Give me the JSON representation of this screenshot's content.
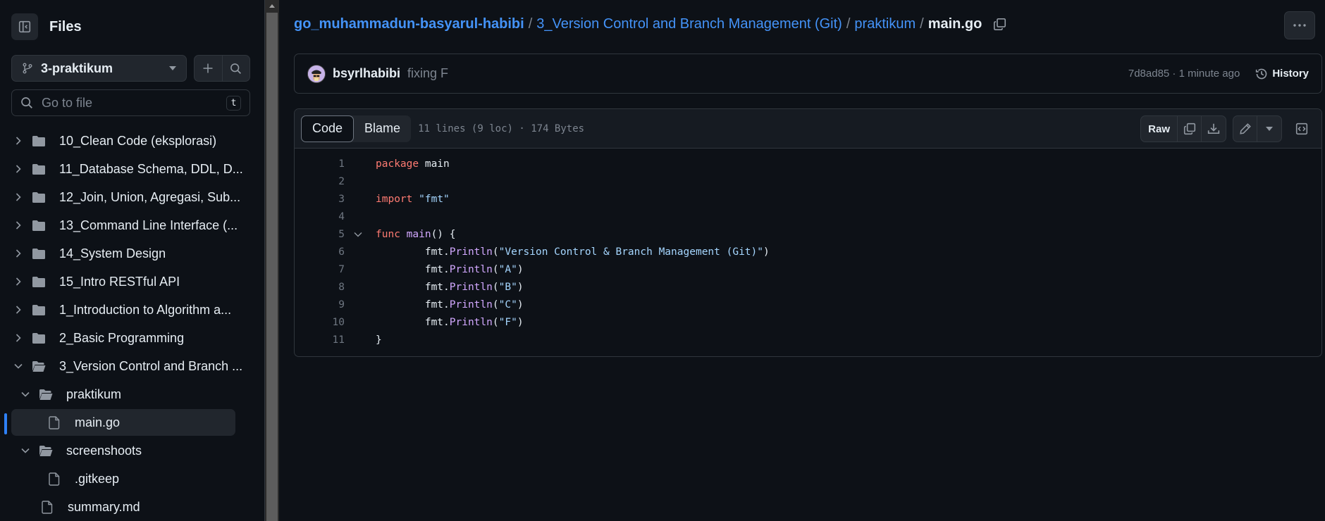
{
  "sidebar": {
    "title": "Files",
    "branch": "3-praktikum",
    "goto_placeholder": "Go to file",
    "goto_shortcut": "t",
    "tree": [
      {
        "label": "10_Clean Code (eksplorasi)",
        "type": "folder",
        "expanded": false
      },
      {
        "label": "11_Database Schema, DDL, D...",
        "type": "folder",
        "expanded": false
      },
      {
        "label": "12_Join, Union, Agregasi, Sub...",
        "type": "folder",
        "expanded": false
      },
      {
        "label": "13_Command Line Interface (...",
        "type": "folder",
        "expanded": false
      },
      {
        "label": "14_System Design",
        "type": "folder",
        "expanded": false
      },
      {
        "label": "15_Intro RESTful API",
        "type": "folder",
        "expanded": false
      },
      {
        "label": "1_Introduction to Algorithm a...",
        "type": "folder",
        "expanded": false
      },
      {
        "label": "2_Basic Programming",
        "type": "folder",
        "expanded": false
      },
      {
        "label": "3_Version Control and Branch ...",
        "type": "folder",
        "expanded": true
      },
      {
        "label": "praktikum",
        "type": "folder",
        "expanded": true
      },
      {
        "label": "main.go",
        "type": "file",
        "selected": true
      },
      {
        "label": "screenshoots",
        "type": "folder",
        "expanded": true
      },
      {
        "label": ".gitkeep",
        "type": "file"
      },
      {
        "label": "summary.md",
        "type": "file"
      }
    ]
  },
  "breadcrumb": {
    "repo": "go_muhammadun-basyarul-habibi",
    "sep": "/",
    "parts": [
      "3_Version Control and Branch Management (Git)",
      "praktikum"
    ],
    "current": "main.go"
  },
  "commit": {
    "author": "bsyrlhabibi",
    "message": "fixing F",
    "meta": "7d8ad85 · 1 minute ago",
    "history_label": "History"
  },
  "file": {
    "tabs": [
      "Code",
      "Blame"
    ],
    "info": "11 lines (9 loc) · 174 Bytes",
    "raw_label": "Raw",
    "lines": [
      {
        "n": "1",
        "tokens": [
          {
            "t": "package",
            "c": "kw"
          },
          {
            "t": " main",
            "c": ""
          }
        ]
      },
      {
        "n": "2",
        "tokens": []
      },
      {
        "n": "3",
        "tokens": [
          {
            "t": "import",
            "c": "kw"
          },
          {
            "t": " ",
            "c": ""
          },
          {
            "t": "\"fmt\"",
            "c": "str"
          }
        ]
      },
      {
        "n": "4",
        "tokens": []
      },
      {
        "n": "5",
        "fold": true,
        "tokens": [
          {
            "t": "func",
            "c": "kw"
          },
          {
            "t": " ",
            "c": ""
          },
          {
            "t": "main",
            "c": "fn"
          },
          {
            "t": "() {",
            "c": ""
          }
        ]
      },
      {
        "n": "6",
        "tokens": [
          {
            "t": "\tfmt.",
            "c": ""
          },
          {
            "t": "Println",
            "c": "fn"
          },
          {
            "t": "(",
            "c": ""
          },
          {
            "t": "\"Version Control & Branch Management (Git)\"",
            "c": "str"
          },
          {
            "t": ")",
            "c": ""
          }
        ]
      },
      {
        "n": "7",
        "tokens": [
          {
            "t": "\tfmt.",
            "c": ""
          },
          {
            "t": "Println",
            "c": "fn"
          },
          {
            "t": "(",
            "c": ""
          },
          {
            "t": "\"A\"",
            "c": "str"
          },
          {
            "t": ")",
            "c": ""
          }
        ]
      },
      {
        "n": "8",
        "tokens": [
          {
            "t": "\tfmt.",
            "c": ""
          },
          {
            "t": "Println",
            "c": "fn"
          },
          {
            "t": "(",
            "c": ""
          },
          {
            "t": "\"B\"",
            "c": "str"
          },
          {
            "t": ")",
            "c": ""
          }
        ]
      },
      {
        "n": "9",
        "tokens": [
          {
            "t": "\tfmt.",
            "c": ""
          },
          {
            "t": "Println",
            "c": "fn"
          },
          {
            "t": "(",
            "c": ""
          },
          {
            "t": "\"C\"",
            "c": "str"
          },
          {
            "t": ")",
            "c": ""
          }
        ]
      },
      {
        "n": "10",
        "tokens": [
          {
            "t": "\tfmt.",
            "c": ""
          },
          {
            "t": "Println",
            "c": "fn"
          },
          {
            "t": "(",
            "c": ""
          },
          {
            "t": "\"F\"",
            "c": "str"
          },
          {
            "t": ")",
            "c": ""
          }
        ]
      },
      {
        "n": "11",
        "tokens": [
          {
            "t": "}",
            "c": ""
          }
        ]
      }
    ]
  },
  "colors": {
    "background": "#0d1117",
    "link": "#4493f8",
    "keyword": "#ff7b72",
    "function": "#d2a8ff",
    "string": "#a5d6ff",
    "muted": "#7d8590"
  }
}
